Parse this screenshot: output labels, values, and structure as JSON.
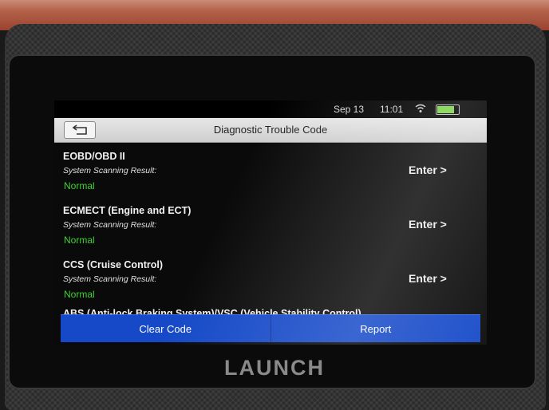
{
  "status_bar": {
    "date": "Sep 13",
    "time": "11:01",
    "battery_level": 0.8
  },
  "header": {
    "title": "Diagnostic Trouble Code"
  },
  "systems": [
    {
      "name": "EOBD/OBD II",
      "result_label": "System Scanning Result:",
      "status": "Normal",
      "action": "Enter >"
    },
    {
      "name": "ECMECT (Engine and ECT)",
      "result_label": "System Scanning Result:",
      "status": "Normal",
      "action": "Enter >"
    },
    {
      "name": "CCS (Cruise Control)",
      "result_label": "System Scanning Result:",
      "status": "Normal",
      "action": "Enter >"
    },
    {
      "name": "ABS (Anti-lock Braking System)/VSC (Vehicle Stability Control)"
    }
  ],
  "footer": {
    "clear_label": "Clear Code",
    "report_label": "Report"
  },
  "brand": {
    "logo": "LAUNCH"
  },
  "colors": {
    "accent": "#1549c8",
    "status_ok": "#3ed234",
    "casing": "#b4624a"
  }
}
